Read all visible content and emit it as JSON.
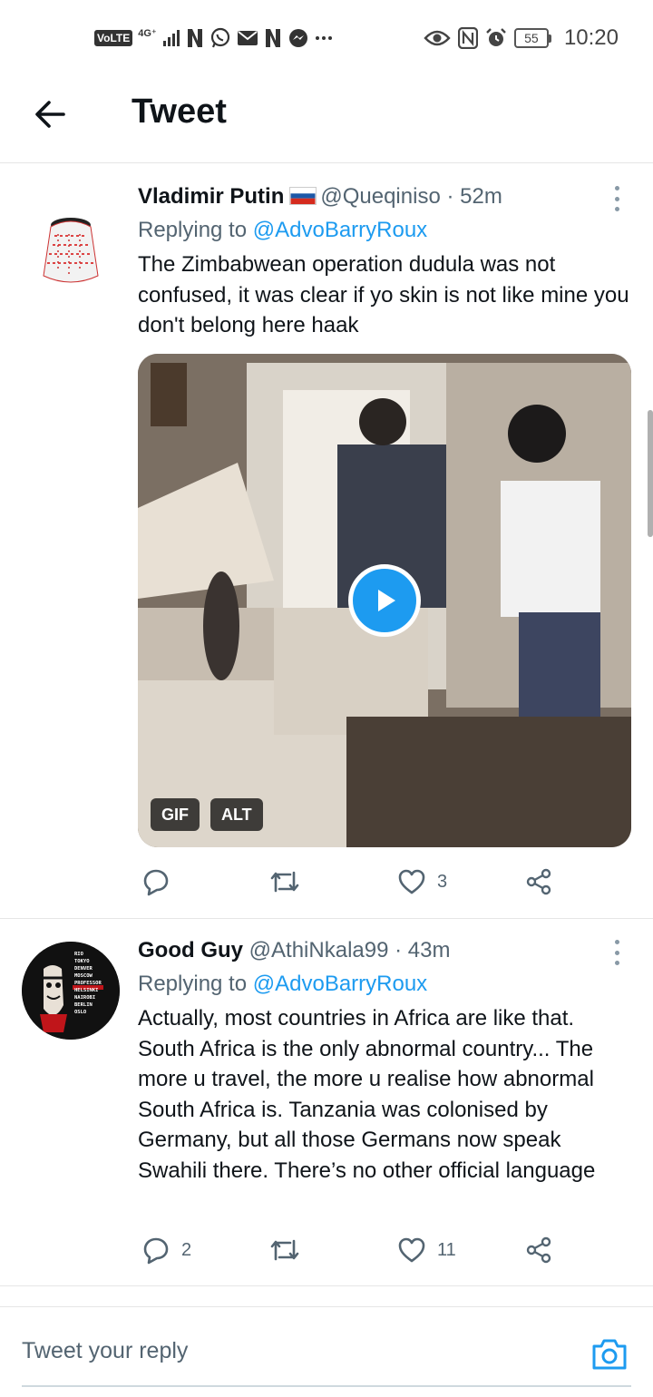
{
  "status_bar": {
    "left_badge": "VoLTE",
    "network": "4G⁺",
    "battery": "55",
    "time": "10:20",
    "icons_left": [
      "signal-icon",
      "netflix-icon",
      "whatsapp-icon",
      "gmail-icon",
      "netflix-icon",
      "messenger-icon",
      "more-dots-icon"
    ],
    "icons_right": [
      "eye-icon",
      "nfc-icon",
      "alarm-icon",
      "battery-icon"
    ]
  },
  "header": {
    "title": "Tweet"
  },
  "tweets": [
    {
      "name": "Vladimir Putin",
      "flag": "🇷🇺",
      "handle": "@Queqiniso",
      "separator": "·",
      "time": "52m",
      "reply_prefix": "Replying to",
      "reply_to": "@AdvoBarryRoux",
      "text": "The Zimbabwean operation dudula was not confused, it was clear if yo skin is not like mine you don't belong here haak",
      "media": {
        "badges": [
          "GIF",
          "ALT"
        ]
      },
      "actions": {
        "replies": "",
        "retweets": "",
        "likes": "3"
      }
    },
    {
      "name": "Good Guy",
      "handle": "@AthiNkala99",
      "separator": "·",
      "time": "43m",
      "reply_prefix": "Replying to",
      "reply_to": "@AdvoBarryRoux",
      "text": "Actually, most countries in Africa are like that. South Africa is the only abnormal country... The more u travel, the more u realise how abnormal South Africa is. Tanzania was colonised by Germany, but all those Germans now speak Swahili there. There’s no other official language",
      "avatar_text": [
        "RIO",
        "TOKYO",
        "DENVER",
        "MOSCOW",
        "PROFESSOR",
        "HELSINKI",
        "NAIROBI",
        "BERLIN",
        "OSLO"
      ],
      "actions": {
        "replies": "2",
        "retweets": "",
        "likes": "11"
      }
    }
  ],
  "composer": {
    "placeholder": "Tweet your reply"
  },
  "colors": {
    "accent": "#1d9bf0",
    "text_primary": "#0f1419",
    "text_secondary": "#536471",
    "divider": "#e6e6e6"
  }
}
